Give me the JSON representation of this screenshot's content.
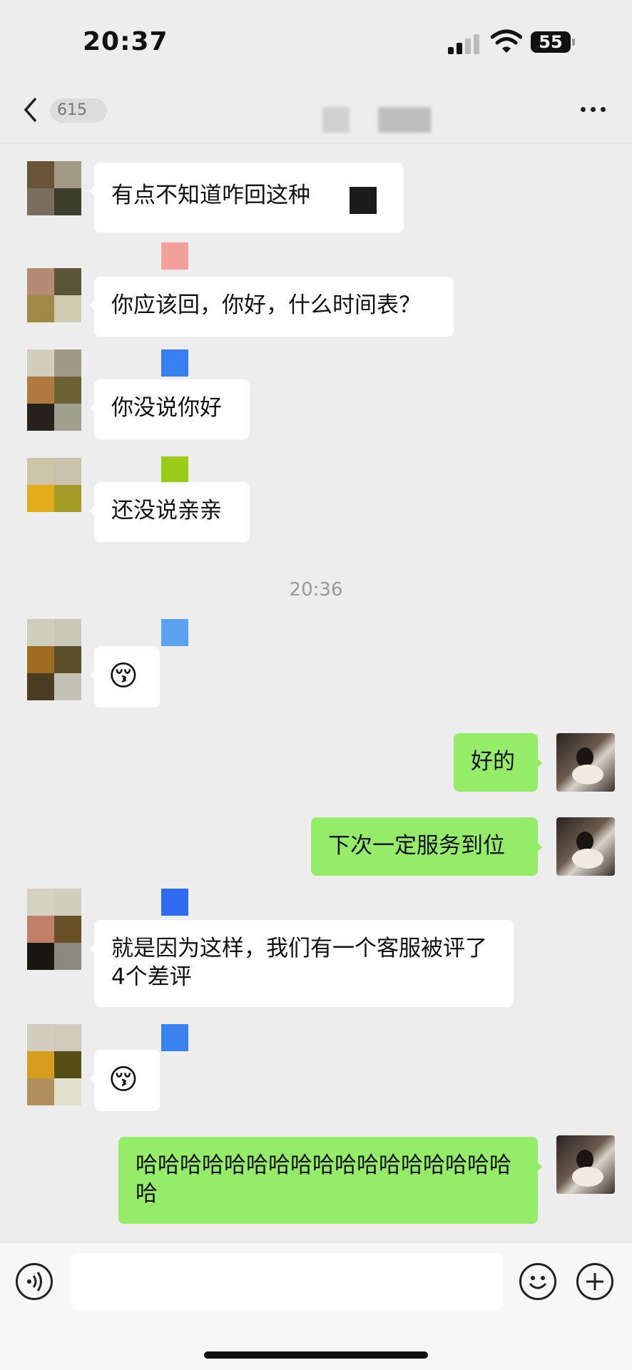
{
  "status_bar": {
    "time": "20:37",
    "battery": "55"
  },
  "nav": {
    "unread_count": "615"
  },
  "timestamp": "20:36",
  "messages": [
    {
      "side": "left",
      "text": "有点不知道咋回这种"
    },
    {
      "side": "left",
      "text": "你应该回，你好，什么时间表？"
    },
    {
      "side": "left",
      "text": "你没说你好"
    },
    {
      "side": "left",
      "text": "还没说亲亲"
    },
    {
      "side": "left",
      "text": "😚"
    },
    {
      "side": "right",
      "text": "好的"
    },
    {
      "side": "right",
      "text": "下次一定服务到位"
    },
    {
      "side": "left",
      "text": "就是因为这样，我们有一个客服被评了4个差评"
    },
    {
      "side": "left",
      "text": "😚"
    },
    {
      "side": "right",
      "text": "哈哈哈哈哈哈哈哈哈哈哈哈哈哈哈哈哈哈"
    }
  ],
  "colors": {
    "background": "#ededed",
    "my_bubble": "#95ec69",
    "their_bubble": "#ffffff"
  },
  "icons": {
    "back": "chevron-left-icon",
    "more": "more-dots-icon",
    "voice": "voice-icon",
    "emoji": "emoji-icon",
    "add": "plus-icon"
  }
}
